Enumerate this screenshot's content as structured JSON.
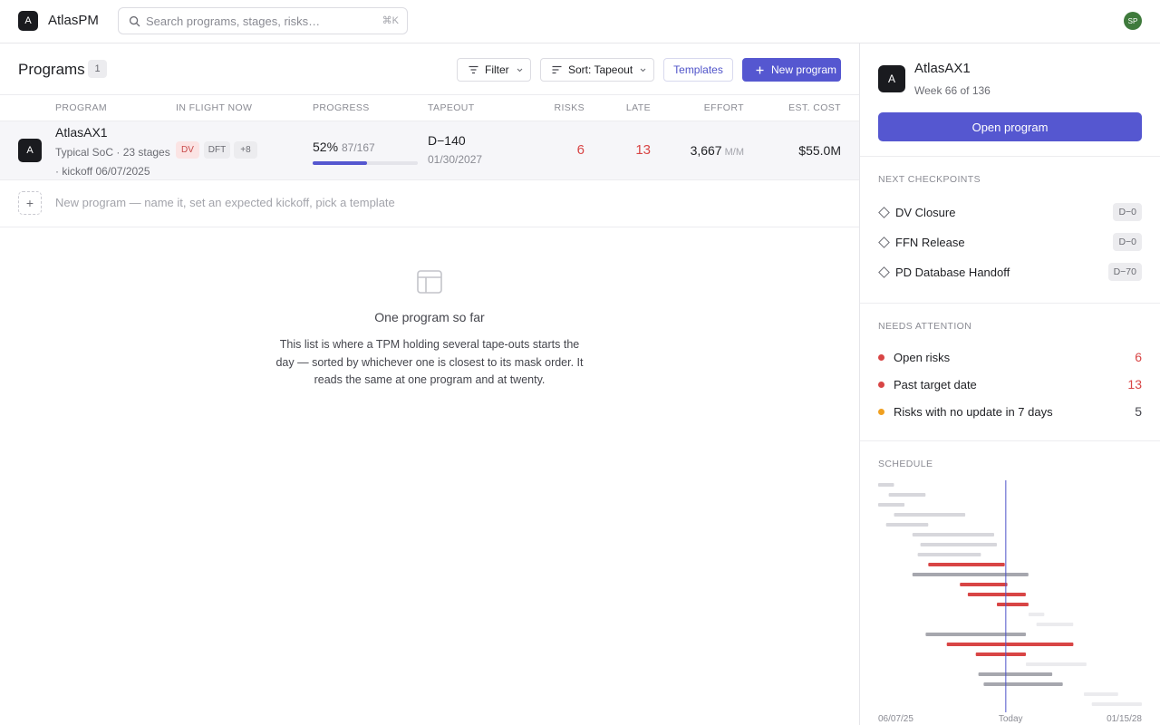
{
  "app": {
    "logo_letter": "A",
    "name": "AtlasPM"
  },
  "search": {
    "placeholder": "Search programs, stages, risks…",
    "shortcut": "⌘K"
  },
  "user": {
    "initials": "SP",
    "color": "#3f7a3c"
  },
  "accent": "#5557d0",
  "programs": {
    "title": "Programs",
    "count": "1",
    "toolbar": {
      "filter_label": "Filter",
      "sort_label": "Sort: Tapeout",
      "templates_label": "Templates",
      "new_label": "New program"
    },
    "columns": [
      "Program",
      "In flight now",
      "Progress",
      "Tapeout",
      "Risks",
      "Late",
      "Effort",
      "Est. cost"
    ],
    "rows": [
      {
        "logo_letter": "A",
        "name": "AtlasAX1",
        "meta": "Typical SoC · 23 stages · kickoff 06/07/2025",
        "chips": [
          "DV",
          "DFT",
          "+8"
        ],
        "progress_pct": "52%",
        "progress_fraction": "87/167",
        "progress_value": 0.52,
        "tapeout_days": "D−140",
        "tapeout_date": "01/30/2027",
        "risks": "6",
        "late": "13",
        "effort": "3,667",
        "effort_unit": "M/M",
        "cost": "$55.0M"
      }
    ],
    "new_row_plus": "+",
    "new_row_text": "New program — name it, set an expected kickoff, pick a template",
    "empty": {
      "title": "One program so far",
      "body": "This list is where a TPM holding several tape-outs starts the day — sorted by whichever one is closest to its mask order. It reads the same at one program and at twenty."
    }
  },
  "panel": {
    "logo_letter": "A",
    "name": "AtlasAX1",
    "week": "Week 66 of 136",
    "open_label": "Open program",
    "checkpoints_title": "Next checkpoints",
    "checkpoints": [
      {
        "label": "DV Closure",
        "badge": "D−0"
      },
      {
        "label": "FFN Release",
        "badge": "D−0"
      },
      {
        "label": "PD Database Handoff",
        "badge": "D−70"
      }
    ],
    "attention_title": "Needs attention",
    "attention": [
      {
        "label": "Open risks",
        "value": "6",
        "color": "#d84545"
      },
      {
        "label": "Past target date",
        "value": "13",
        "color": "#d84545"
      },
      {
        "label": "Risks with no update in 7 days",
        "value": "5",
        "color": "#f0a020"
      }
    ],
    "schedule_title": "Schedule",
    "schedule": {
      "start_label": "06/07/25",
      "today_label": "Today",
      "end_label": "01/15/28",
      "today_fraction": 0.484,
      "bars": [
        {
          "start": 0.0,
          "end": 0.06,
          "status": "done"
        },
        {
          "start": 0.04,
          "end": 0.18,
          "status": "done"
        },
        {
          "start": 0.0,
          "end": 0.1,
          "status": "done"
        },
        {
          "start": 0.06,
          "end": 0.33,
          "status": "done"
        },
        {
          "start": 0.03,
          "end": 0.19,
          "status": "done"
        },
        {
          "start": 0.13,
          "end": 0.44,
          "status": "done"
        },
        {
          "start": 0.16,
          "end": 0.45,
          "status": "done"
        },
        {
          "start": 0.15,
          "end": 0.39,
          "status": "done"
        },
        {
          "start": 0.19,
          "end": 0.48,
          "status": "late"
        },
        {
          "start": 0.13,
          "end": 0.57,
          "status": "active"
        },
        {
          "start": 0.31,
          "end": 0.49,
          "status": "late"
        },
        {
          "start": 0.34,
          "end": 0.56,
          "status": "late"
        },
        {
          "start": 0.45,
          "end": 0.57,
          "status": "late"
        },
        {
          "start": 0.57,
          "end": 0.63,
          "status": "future"
        },
        {
          "start": 0.6,
          "end": 0.74,
          "status": "future"
        },
        {
          "start": 0.18,
          "end": 0.56,
          "status": "active"
        },
        {
          "start": 0.26,
          "end": 0.74,
          "status": "late"
        },
        {
          "start": 0.37,
          "end": 0.56,
          "status": "late"
        },
        {
          "start": 0.56,
          "end": 0.79,
          "status": "future"
        },
        {
          "start": 0.38,
          "end": 0.66,
          "status": "active"
        },
        {
          "start": 0.4,
          "end": 0.7,
          "status": "active"
        },
        {
          "start": 0.78,
          "end": 0.91,
          "status": "future"
        },
        {
          "start": 0.81,
          "end": 1.0,
          "status": "future"
        }
      ],
      "colors": {
        "done": "#d7d7dc",
        "active": "#a6a7ae",
        "late": "#d84545",
        "future": "#ebebee",
        "today": "#4f53c9"
      }
    }
  }
}
